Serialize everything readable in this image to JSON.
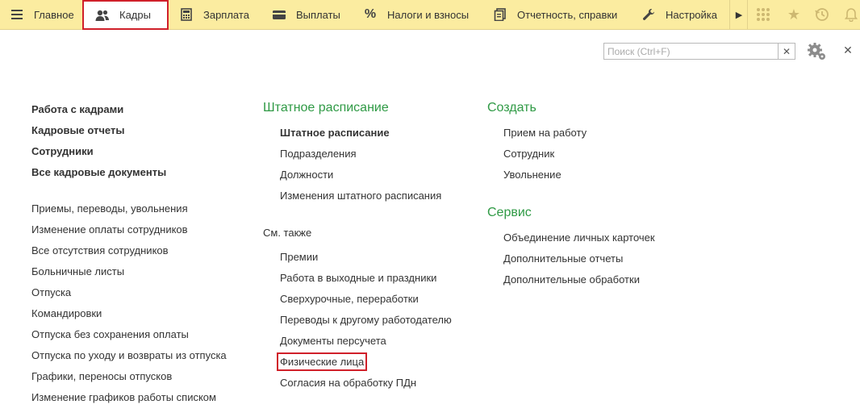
{
  "nav": {
    "items": [
      {
        "label": "Главное",
        "icon": "hamburger-menu-icon"
      },
      {
        "label": "Кадры",
        "icon": "users-icon",
        "active": true
      },
      {
        "label": "Зарплата",
        "icon": "calculator-icon"
      },
      {
        "label": "Выплаты",
        "icon": "wallet-icon"
      },
      {
        "label": "Налоги и взносы",
        "icon": "percent-icon"
      },
      {
        "label": "Отчетность, справки",
        "icon": "documents-icon"
      },
      {
        "label": "Настройка",
        "icon": "wrench-icon"
      }
    ],
    "right_icons": [
      "arrow-right-icon",
      "apps-grid-icon",
      "star-icon",
      "history-icon",
      "bell-icon"
    ],
    "accent_color": "#fbeca0",
    "highlight_color": "#d0202a"
  },
  "search": {
    "placeholder": "Поиск (Ctrl+F)",
    "value": ""
  },
  "left": {
    "bold_links": [
      "Работа с кадрами",
      "Кадровые отчеты",
      "Сотрудники",
      "Все кадровые документы"
    ],
    "links": [
      "Приемы, переводы, увольнения",
      "Изменение оплаты сотрудников",
      "Все отсутствия сотрудников",
      "Больничные листы",
      "Отпуска",
      "Командировки",
      "Отпуска без сохранения оплаты",
      "Отпуска по уходу и возвраты из отпуска",
      "Графики, переносы отпусков",
      "Изменение графиков работы списком"
    ]
  },
  "middle": {
    "group_title": "Штатное расписание",
    "links": [
      "Штатное расписание",
      "Подразделения",
      "Должности",
      "Изменения штатного расписания"
    ],
    "see_also_title": "См. также",
    "see_also": [
      "Премии",
      "Работа в выходные и праздники",
      "Сверхурочные, переработки",
      "Переводы к другому работодателю",
      "Документы персучета",
      "Физические лица",
      "Согласия на обработку ПДн"
    ]
  },
  "right": {
    "create_title": "Создать",
    "create_links": [
      "Прием на работу",
      "Сотрудник",
      "Увольнение"
    ],
    "service_title": "Сервис",
    "service_links": [
      "Объединение личных карточек",
      "Дополнительные отчеты",
      "Дополнительные обработки"
    ]
  },
  "group_title_color": "#2f9a45"
}
